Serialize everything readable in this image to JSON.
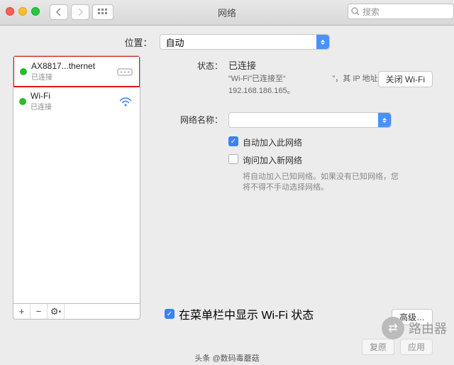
{
  "window": {
    "title": "网络"
  },
  "search": {
    "placeholder": "搜索"
  },
  "location": {
    "label": "位置：",
    "value": "自动"
  },
  "sidebar": {
    "items": [
      {
        "name": "AX8817...thernet",
        "status": "已连接",
        "icon": "ethernet"
      },
      {
        "name": "Wi-Fi",
        "status": "已连接",
        "icon": "wifi"
      }
    ]
  },
  "toolbar": {
    "add": "+",
    "remove": "−",
    "gear": "⚙"
  },
  "detail": {
    "status_label": "状态：",
    "status_value": "已连接",
    "status_sub": "“Wi-Fi”已连接至“　　　　　　”，其 IP 地址为 192.168.186.165。",
    "wifi_button": "关闭 Wi-Fi",
    "netname_label": "网络名称：",
    "auto_join": "自动加入此网络",
    "ask_join": "询问加入新网络",
    "ask_desc": "将自动加入已知网络。如果没有已知网络，您将不得不手动选择网络。",
    "menubar": "在菜单栏中显示 Wi-Fi 状态",
    "advanced": "高级…"
  },
  "buttons": {
    "revert": "复原",
    "apply": "应用"
  },
  "watermark": {
    "text": "路由器"
  },
  "credit": "头条 @数码毒蘑菇"
}
